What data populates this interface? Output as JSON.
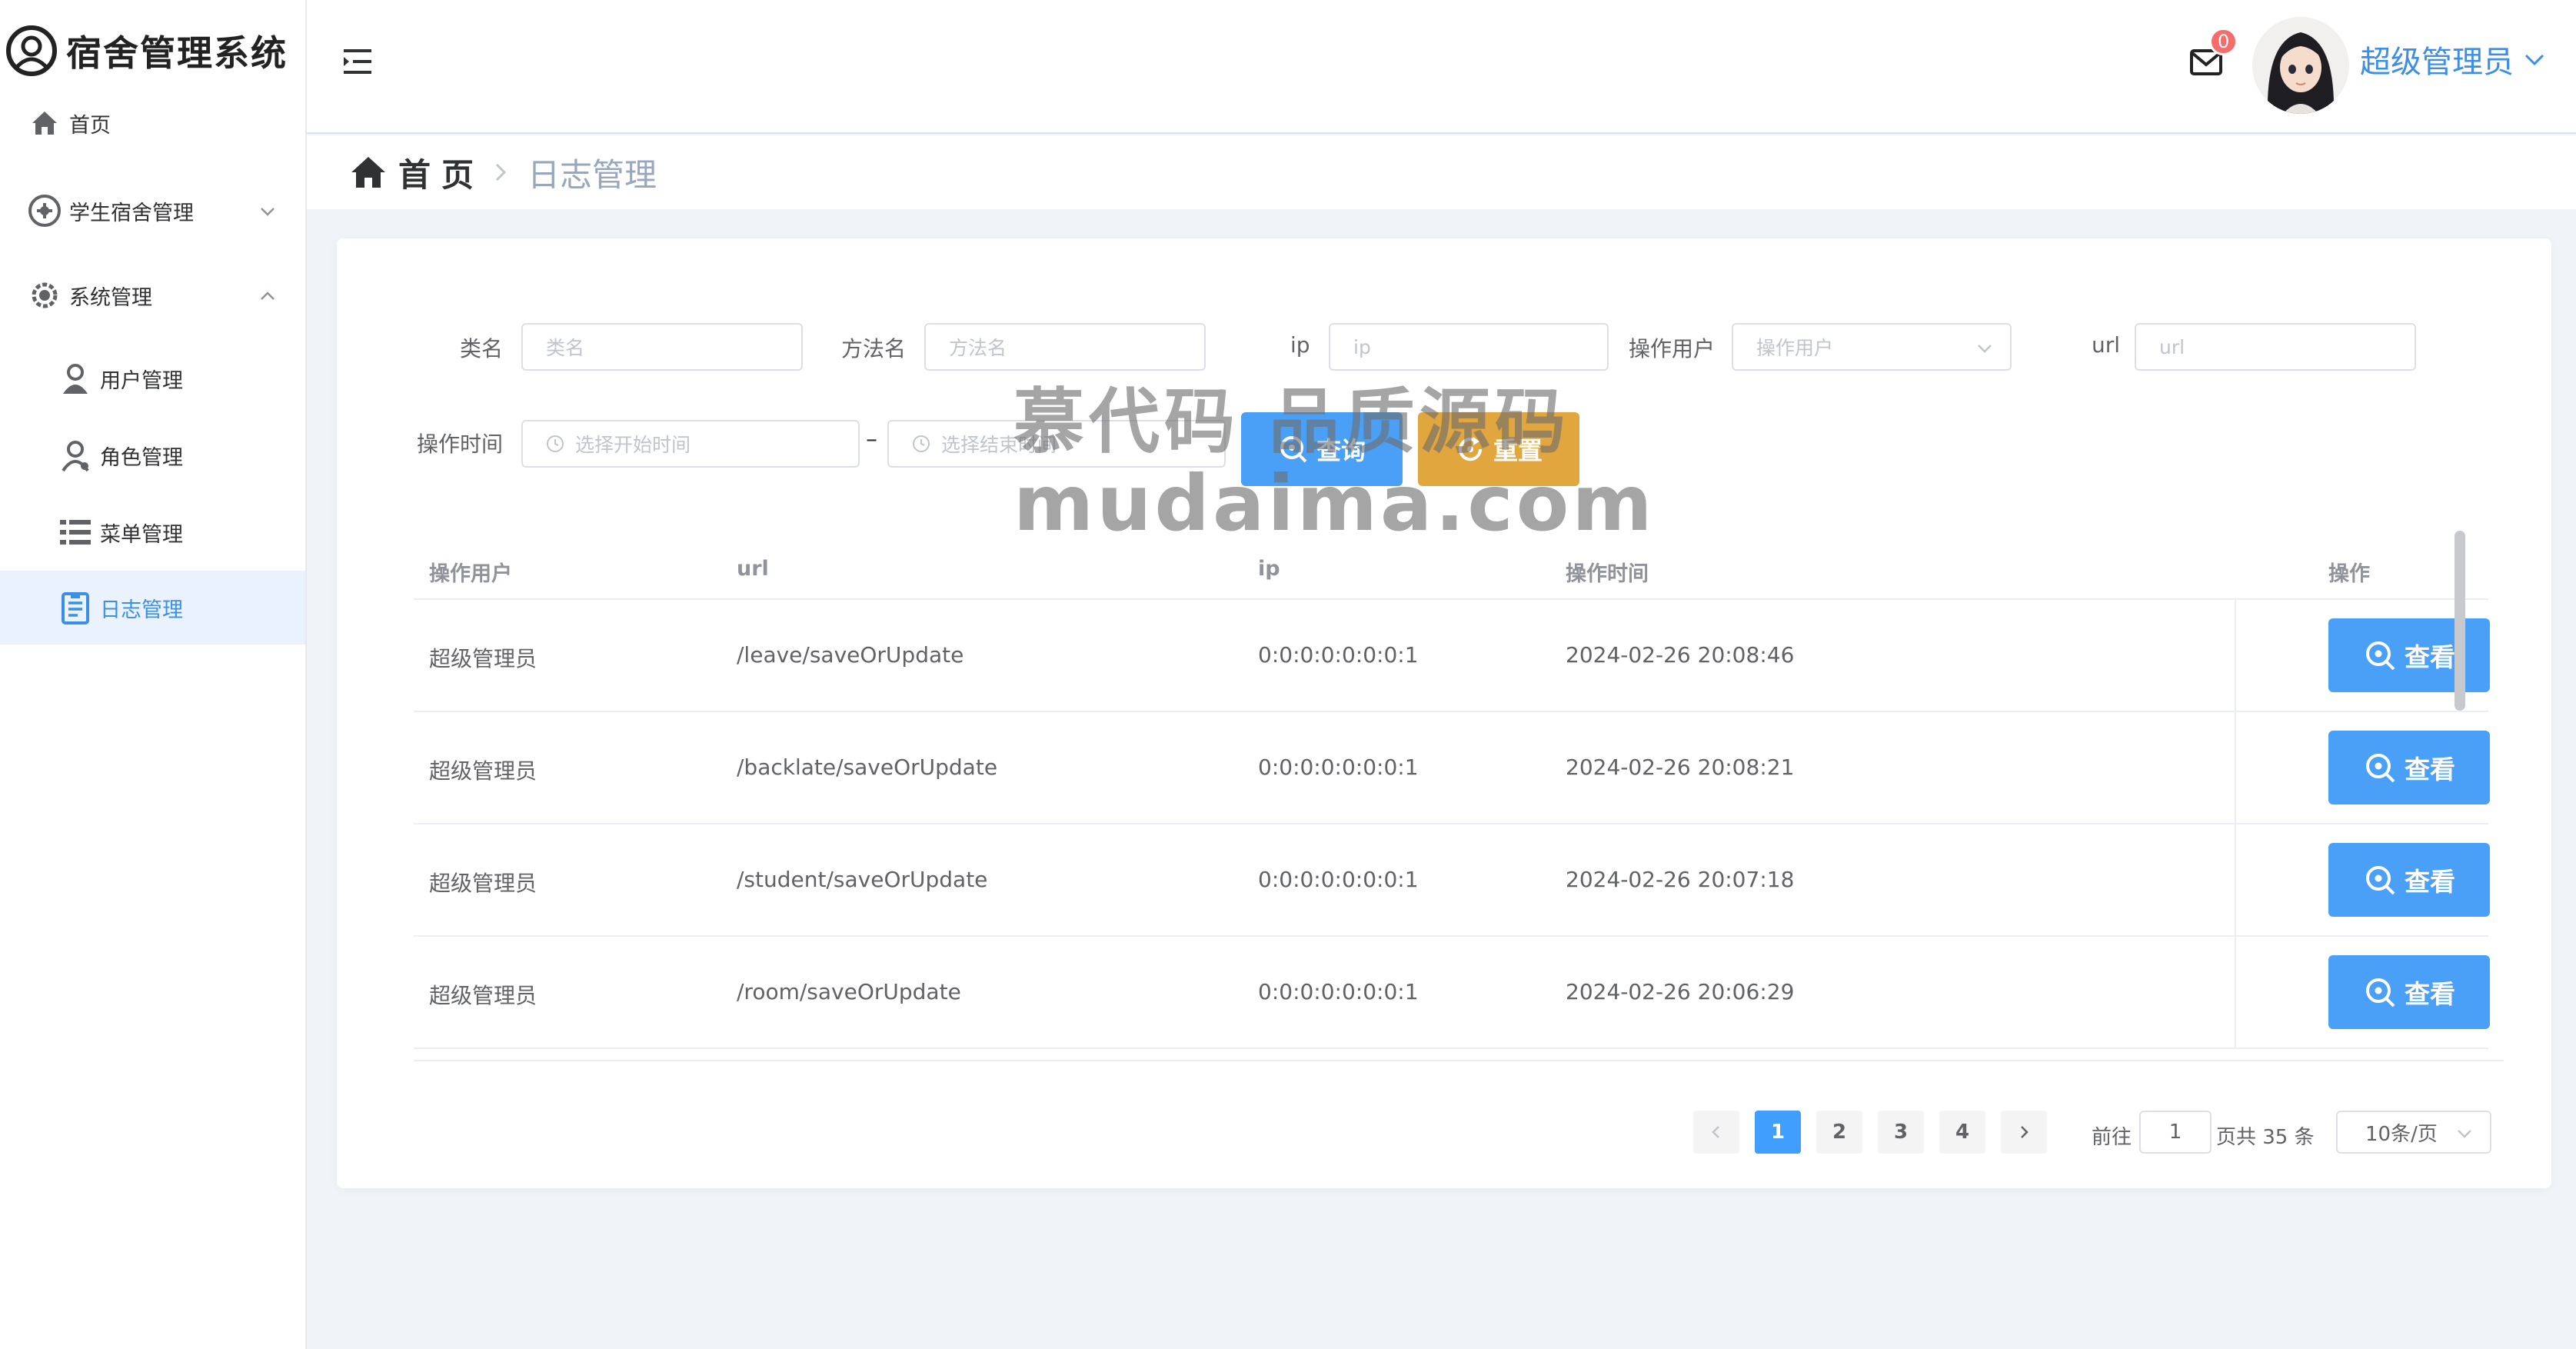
{
  "app": {
    "title": "宿舍管理系统"
  },
  "sidebar": {
    "items": [
      {
        "label": "首页"
      },
      {
        "label": "学生宿舍管理"
      },
      {
        "label": "系统管理"
      },
      {
        "label": "用户管理"
      },
      {
        "label": "角色管理"
      },
      {
        "label": "菜单管理"
      },
      {
        "label": "日志管理"
      }
    ],
    "active_index": 6
  },
  "header": {
    "badge_count": "0",
    "user_name": "超级管理员"
  },
  "breadcrumb": {
    "home": "首页",
    "current": "日志管理"
  },
  "filters": {
    "class_name": {
      "label": "类名",
      "placeholder": "类名"
    },
    "method_name": {
      "label": "方法名",
      "placeholder": "方法名"
    },
    "ip": {
      "label": "ip",
      "placeholder": "ip"
    },
    "operator": {
      "label": "操作用户",
      "placeholder": "操作用户"
    },
    "url": {
      "label": "url",
      "placeholder": "url"
    },
    "time": {
      "label": "操作时间",
      "start_placeholder": "选择开始时间",
      "separator": "–",
      "end_placeholder": "选择结束时间"
    },
    "search_label": "查询",
    "reset_label": "重置"
  },
  "table": {
    "columns": [
      "操作用户",
      "url",
      "ip",
      "操作时间",
      "操作"
    ],
    "rows": [
      {
        "user": "超级管理员",
        "url": "/leave/saveOrUpdate",
        "ip": "0:0:0:0:0:0:0:1",
        "time": "2024-02-26 20:08:46",
        "action": "查看"
      },
      {
        "user": "超级管理员",
        "url": "/backlate/saveOrUpdate",
        "ip": "0:0:0:0:0:0:0:1",
        "time": "2024-02-26 20:08:21",
        "action": "查看"
      },
      {
        "user": "超级管理员",
        "url": "/student/saveOrUpdate",
        "ip": "0:0:0:0:0:0:0:1",
        "time": "2024-02-26 20:07:18",
        "action": "查看"
      },
      {
        "user": "超级管理员",
        "url": "/room/saveOrUpdate",
        "ip": "0:0:0:0:0:0:0:1",
        "time": "2024-02-26 20:06:29",
        "action": "查看"
      }
    ]
  },
  "pagination": {
    "pages": [
      "1",
      "2",
      "3",
      "4"
    ],
    "current": "1",
    "goto_label": "前往",
    "goto_value": "1",
    "total_label": "页共 35 条",
    "page_size": "10条/页"
  },
  "watermark": {
    "line1": "慕代码 品质源码",
    "line2": "mudaima.com"
  },
  "colors": {
    "primary": "#409eff",
    "button_blue": "#4aa0f7",
    "warning": "#e2a63e",
    "badge": "#f56c6c",
    "active_text": "#3d8ee6"
  }
}
